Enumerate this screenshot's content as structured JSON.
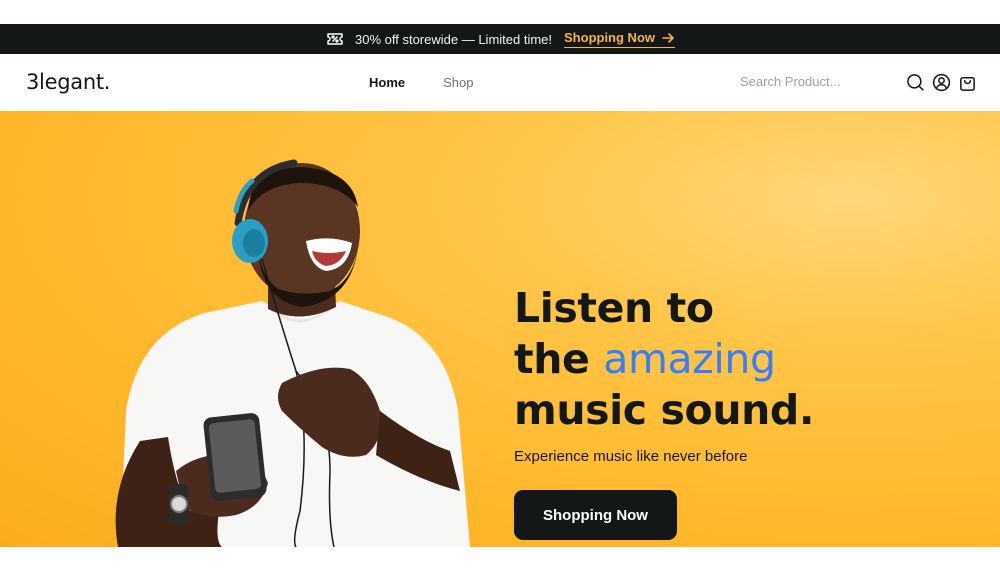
{
  "promo": {
    "text": "30% off storewide — Limited time!",
    "link_label": "Shopping Now",
    "icon": "ticket-icon",
    "link_color": "#f5b545"
  },
  "nav": {
    "logo": "3legant.",
    "menu": [
      {
        "label": "Home",
        "active": true
      },
      {
        "label": "Shop",
        "active": false
      }
    ],
    "search_placeholder": "Search Product...",
    "icons": [
      "search-icon",
      "user-icon",
      "shopping-bag-icon"
    ]
  },
  "hero": {
    "headline_line1": "Listen to",
    "headline_line2_prefix": "the ",
    "headline_line2_accent": "amazing",
    "headline_line3": "music sound.",
    "subline": "Experience music like never before",
    "cta_label": "Shopping Now",
    "background_color": "#ffb72a",
    "accent_color": "#377dff",
    "image": "man-with-headphones-holding-phone"
  }
}
